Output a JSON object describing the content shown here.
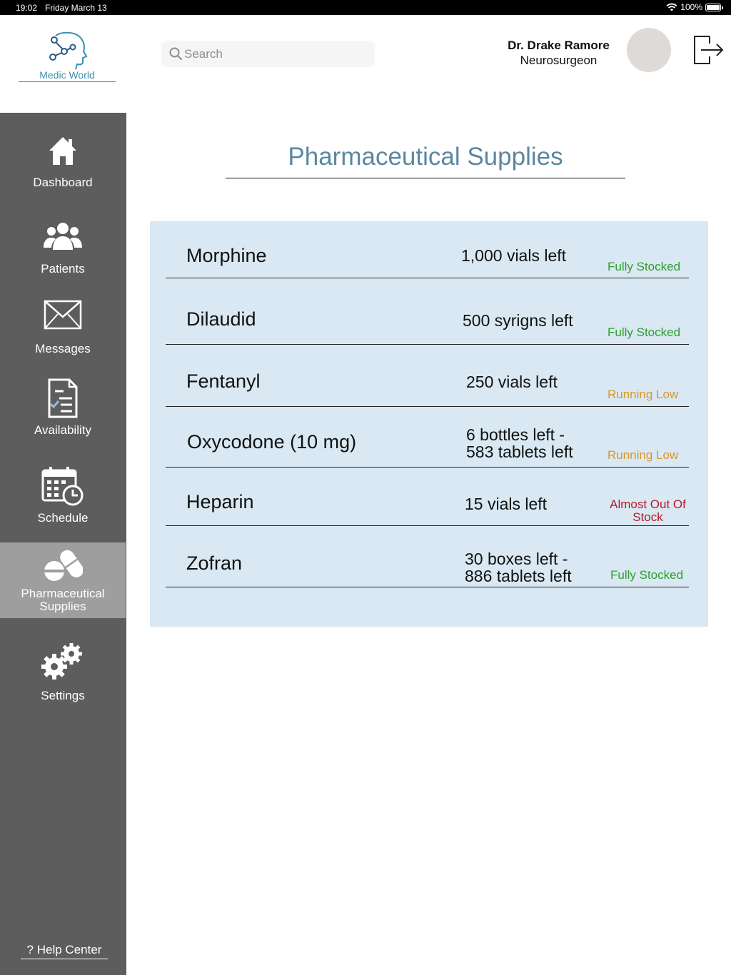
{
  "status_bar": {
    "time": "19:02",
    "date": "Friday March 13",
    "battery": "100%"
  },
  "brand": {
    "name": "Medic World"
  },
  "search": {
    "placeholder": "Search"
  },
  "user": {
    "name": "Dr. Drake Ramore",
    "role": "Neurosurgeon"
  },
  "sidebar": {
    "items": [
      {
        "label": "Dashboard",
        "icon": "home-icon"
      },
      {
        "label": "Patients",
        "icon": "people-icon"
      },
      {
        "label": "Messages",
        "icon": "envelope-icon"
      },
      {
        "label": "Availability",
        "icon": "checklist-icon"
      },
      {
        "label": "Schedule",
        "icon": "calendar-clock-icon"
      },
      {
        "label": "Pharmaceutical Supplies",
        "icon": "pills-icon",
        "active": true
      },
      {
        "label": "Settings",
        "icon": "gears-icon"
      }
    ],
    "help": "? Help Center"
  },
  "main": {
    "title": "Pharmaceutical Supplies",
    "supplies": [
      {
        "drug": "Morphine",
        "qty_line1": "1,000 vials left",
        "qty_line2": "",
        "status": "Fully Stocked",
        "status_line2": "",
        "level": "ok"
      },
      {
        "drug": "Dilaudid",
        "qty_line1": "500 syrigns left",
        "qty_line2": "",
        "status": "Fully Stocked",
        "status_line2": "",
        "level": "ok"
      },
      {
        "drug": "Fentanyl",
        "qty_line1": "250 vials left",
        "qty_line2": "",
        "status": "Running Low",
        "status_line2": "",
        "level": "low"
      },
      {
        "drug": "Oxycodone (10 mg)",
        "qty_line1": "6 bottles left -",
        "qty_line2": "583 tablets left",
        "status": "Running Low",
        "status_line2": "",
        "level": "low"
      },
      {
        "drug": "Heparin",
        "qty_line1": "15 vials left",
        "qty_line2": "",
        "status": "Almost Out Of",
        "status_line2": "Stock",
        "level": "out"
      },
      {
        "drug": "Zofran",
        "qty_line1": "30 boxes left -",
        "qty_line2": "886 tablets left",
        "status": "Fully Stocked",
        "status_line2": "",
        "level": "ok"
      }
    ]
  },
  "colors": {
    "accent": "#5b87a0",
    "sidebar": "#5d5d5d",
    "sidebar_active": "#9e9e9e",
    "panel": "#d9e8f2",
    "fully_stocked": "#2e9e2e",
    "running_low": "#d9982a",
    "almost_out": "#b31a2a"
  }
}
